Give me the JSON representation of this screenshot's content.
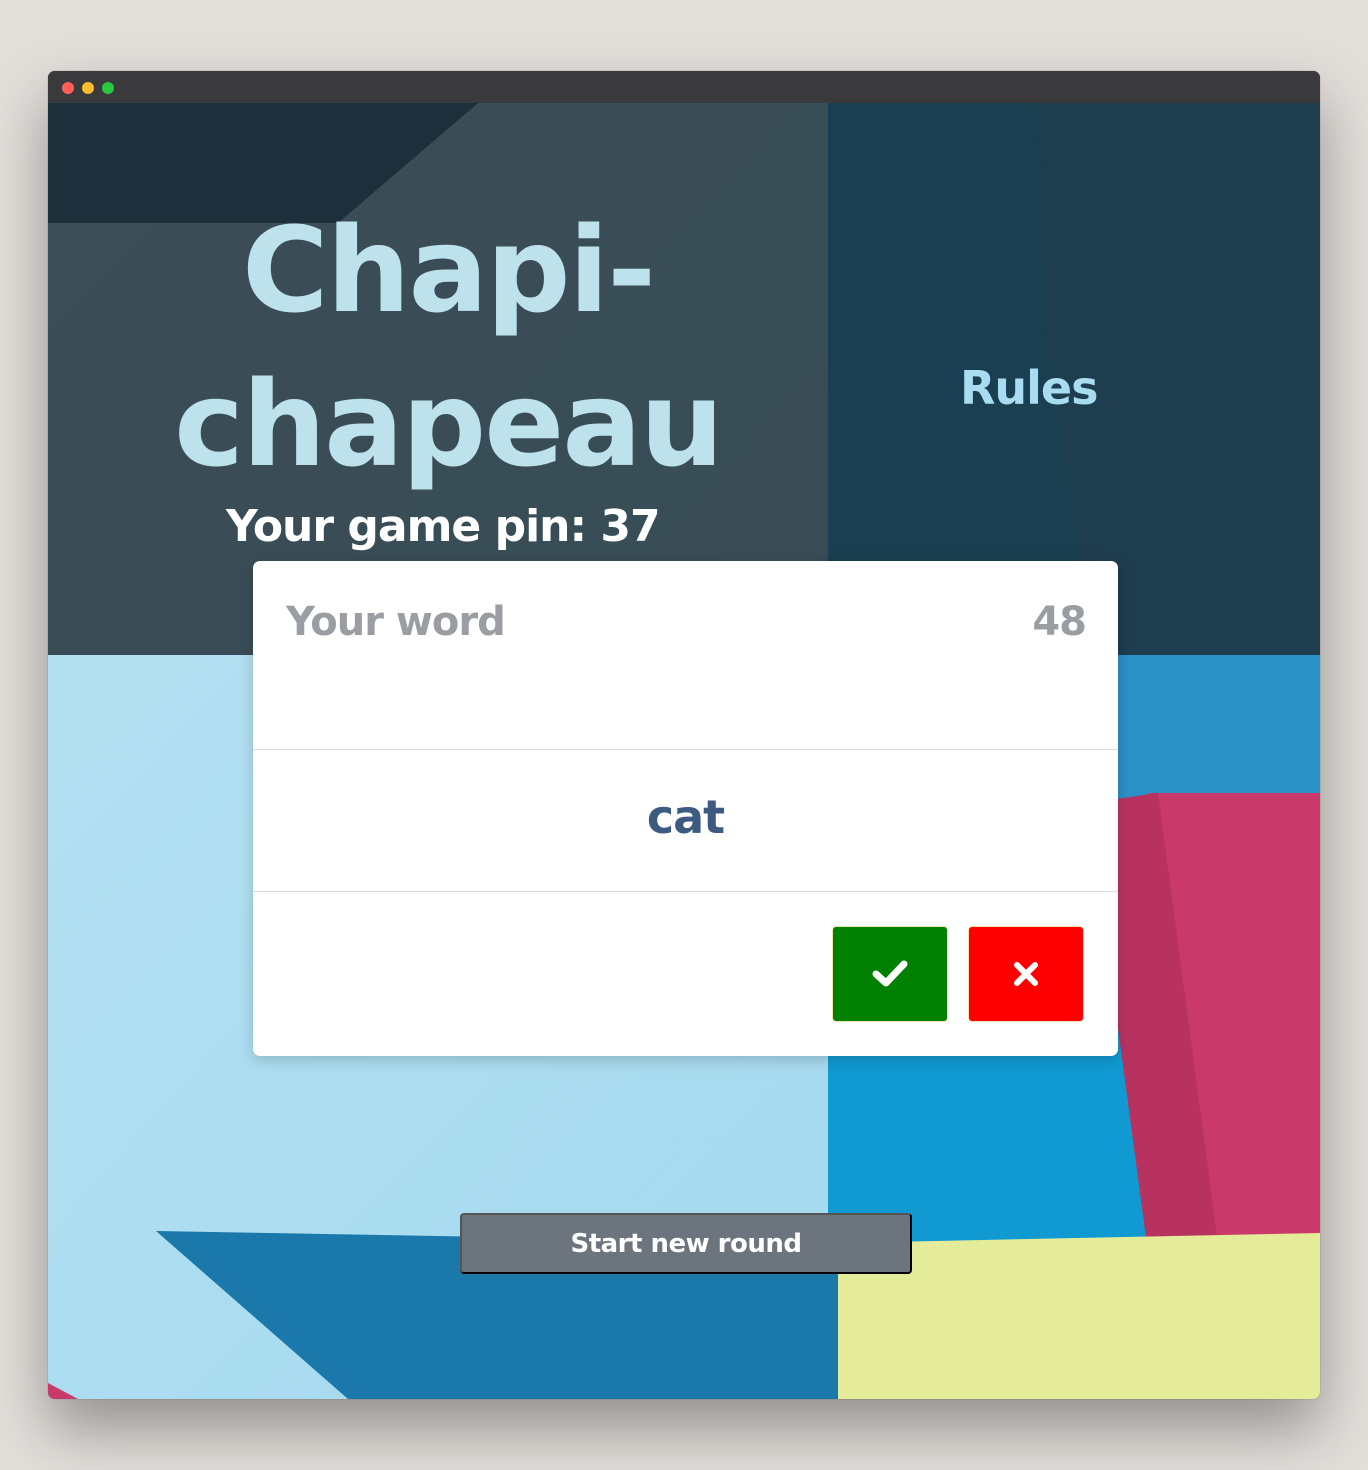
{
  "header": {
    "title_line1": "Chapi-",
    "title_line2": "chapeau",
    "rules_label": "Rules",
    "game_pin_text": "Your game pin: 37"
  },
  "card": {
    "label": "Your word",
    "timer": "48",
    "word": "cat",
    "correct_icon": "check-icon",
    "wrong_icon": "close-icon"
  },
  "footer": {
    "new_round_label": "Start new round"
  },
  "colors": {
    "title": "#bde2ec",
    "rules": "#a9dcf0",
    "word": "#3d5a80",
    "correct": "#008000",
    "wrong": "#ff0000",
    "secondary_button": "#6c757d"
  }
}
